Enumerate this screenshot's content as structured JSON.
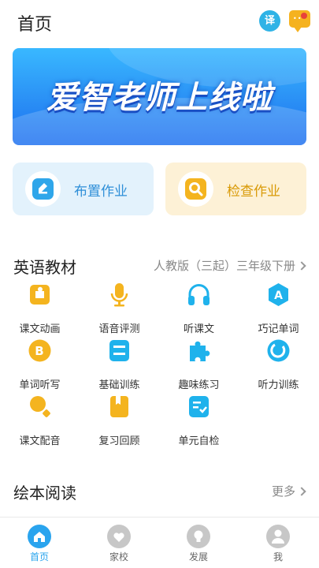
{
  "header": {
    "title": "首页",
    "translate_label": "译"
  },
  "banner": {
    "text": "爱智老师上线啦"
  },
  "actions": {
    "assign_label": "布置作业",
    "check_label": "检查作业"
  },
  "english": {
    "title": "英语教材",
    "edition": "人教版（三起）三年级下册",
    "items": [
      {
        "label": "课文动画",
        "icon": "puzzle-piece-icon",
        "color": "#f4b41f"
      },
      {
        "label": "语音评测",
        "icon": "microphone-icon",
        "color": "#f4b41f"
      },
      {
        "label": "听课文",
        "icon": "headphones-icon",
        "color": "#1fb2ec"
      },
      {
        "label": "巧记单词",
        "icon": "letter-a-hexagon-icon",
        "color": "#1fb2ec"
      },
      {
        "label": "单词听写",
        "icon": "letter-b-circle-icon",
        "color": "#f4b41f"
      },
      {
        "label": "基础训练",
        "icon": "blocks-icon",
        "color": "#1fb2ec"
      },
      {
        "label": "趣味练习",
        "icon": "jigsaw-icon",
        "color": "#1fb2ec"
      },
      {
        "label": "听力训练",
        "icon": "ear-swirl-icon",
        "color": "#1fb2ec"
      },
      {
        "label": "课文配音",
        "icon": "dubbing-icon",
        "color": "#f4b41f"
      },
      {
        "label": "复习回顾",
        "icon": "book-icon",
        "color": "#f4b41f"
      },
      {
        "label": "单元自检",
        "icon": "checklist-icon",
        "color": "#1fb2ec"
      }
    ]
  },
  "picture_books": {
    "title": "绘本阅读",
    "more": "更多"
  },
  "tabs": [
    {
      "label": "首页",
      "icon": "home-icon",
      "active": true
    },
    {
      "label": "家校",
      "icon": "heart-chat-icon",
      "active": false
    },
    {
      "label": "发展",
      "icon": "lightbulb-icon",
      "active": false
    },
    {
      "label": "我",
      "icon": "user-icon",
      "active": false
    }
  ],
  "colors": {
    "accent": "#2aa4ee",
    "yellow": "#f4b41f"
  }
}
